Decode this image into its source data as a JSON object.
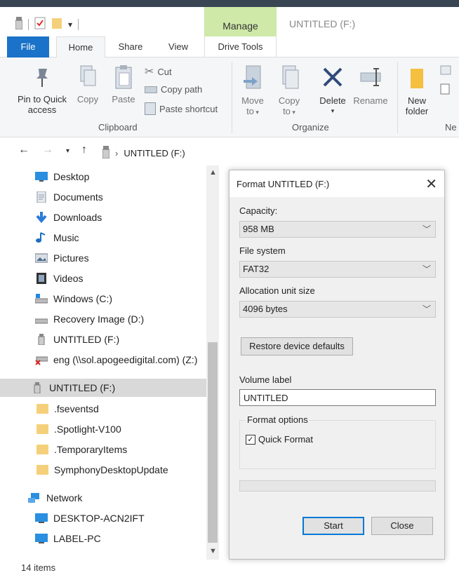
{
  "window": {
    "title": "UNTITLED (F:)",
    "contextual_tab_group": "Manage"
  },
  "tabs": {
    "file": "File",
    "home": "Home",
    "share": "Share",
    "view": "View",
    "drive_tools": "Drive Tools"
  },
  "ribbon": {
    "clipboard": {
      "pin_to_quick_access": "Pin to Quick access",
      "copy": "Copy",
      "paste": "Paste",
      "cut": "Cut",
      "copy_path": "Copy path",
      "paste_shortcut": "Paste shortcut",
      "group_label": "Clipboard"
    },
    "organize": {
      "move_to": "Move to",
      "copy_to": "Copy to",
      "delete": "Delete",
      "rename": "Rename",
      "group_label": "Organize"
    },
    "new": {
      "new_folder": "New folder",
      "group_label": "Ne"
    }
  },
  "address": {
    "path": "UNTITLED (F:)"
  },
  "nav": {
    "items": [
      {
        "label": "Desktop",
        "icon": "desktop-icon"
      },
      {
        "label": "Documents",
        "icon": "documents-icon"
      },
      {
        "label": "Downloads",
        "icon": "downloads-icon"
      },
      {
        "label": "Music",
        "icon": "music-icon"
      },
      {
        "label": "Pictures",
        "icon": "pictures-icon"
      },
      {
        "label": "Videos",
        "icon": "videos-icon"
      },
      {
        "label": "Windows (C:)",
        "icon": "drive-icon"
      },
      {
        "label": "Recovery Image (D:)",
        "icon": "drive-icon"
      },
      {
        "label": "UNTITLED (F:)",
        "icon": "usb-drive-icon"
      },
      {
        "label": "eng (\\\\sol.apogeedigital.com) (Z:)",
        "icon": "network-drive-disconnected-icon"
      },
      {
        "label": "UNTITLED (F:)",
        "icon": "usb-drive-icon",
        "selected": true
      },
      {
        "label": ".fseventsd",
        "icon": "folder-icon"
      },
      {
        "label": ".Spotlight-V100",
        "icon": "folder-icon"
      },
      {
        "label": ".TemporaryItems",
        "icon": "folder-icon"
      },
      {
        "label": "SymphonyDesktopUpdate",
        "icon": "folder-icon"
      },
      {
        "label": "Network",
        "icon": "network-icon"
      },
      {
        "label": "DESKTOP-ACN2IFT",
        "icon": "computer-icon"
      },
      {
        "label": "LABEL-PC",
        "icon": "computer-icon"
      }
    ]
  },
  "status": {
    "items_count": "14 items"
  },
  "dialog": {
    "title": "Format UNTITLED (F:)",
    "capacity_label": "Capacity:",
    "capacity_value": "958 MB",
    "file_system_label": "File system",
    "file_system_value": "FAT32",
    "allocation_label": "Allocation unit size",
    "allocation_value": "4096 bytes",
    "restore_defaults": "Restore device defaults",
    "volume_label_label": "Volume label",
    "volume_label_value": "UNTITLED",
    "format_options_label": "Format options",
    "quick_format_label": "Quick Format",
    "quick_format_checked": true,
    "progress": 0,
    "start": "Start",
    "close": "Close"
  },
  "colors": {
    "file_tab": "#1a73c8",
    "manage_tab": "#cfe9a9",
    "selected_nav": "#d9d9d9",
    "primary_button_border": "#0078d7"
  }
}
